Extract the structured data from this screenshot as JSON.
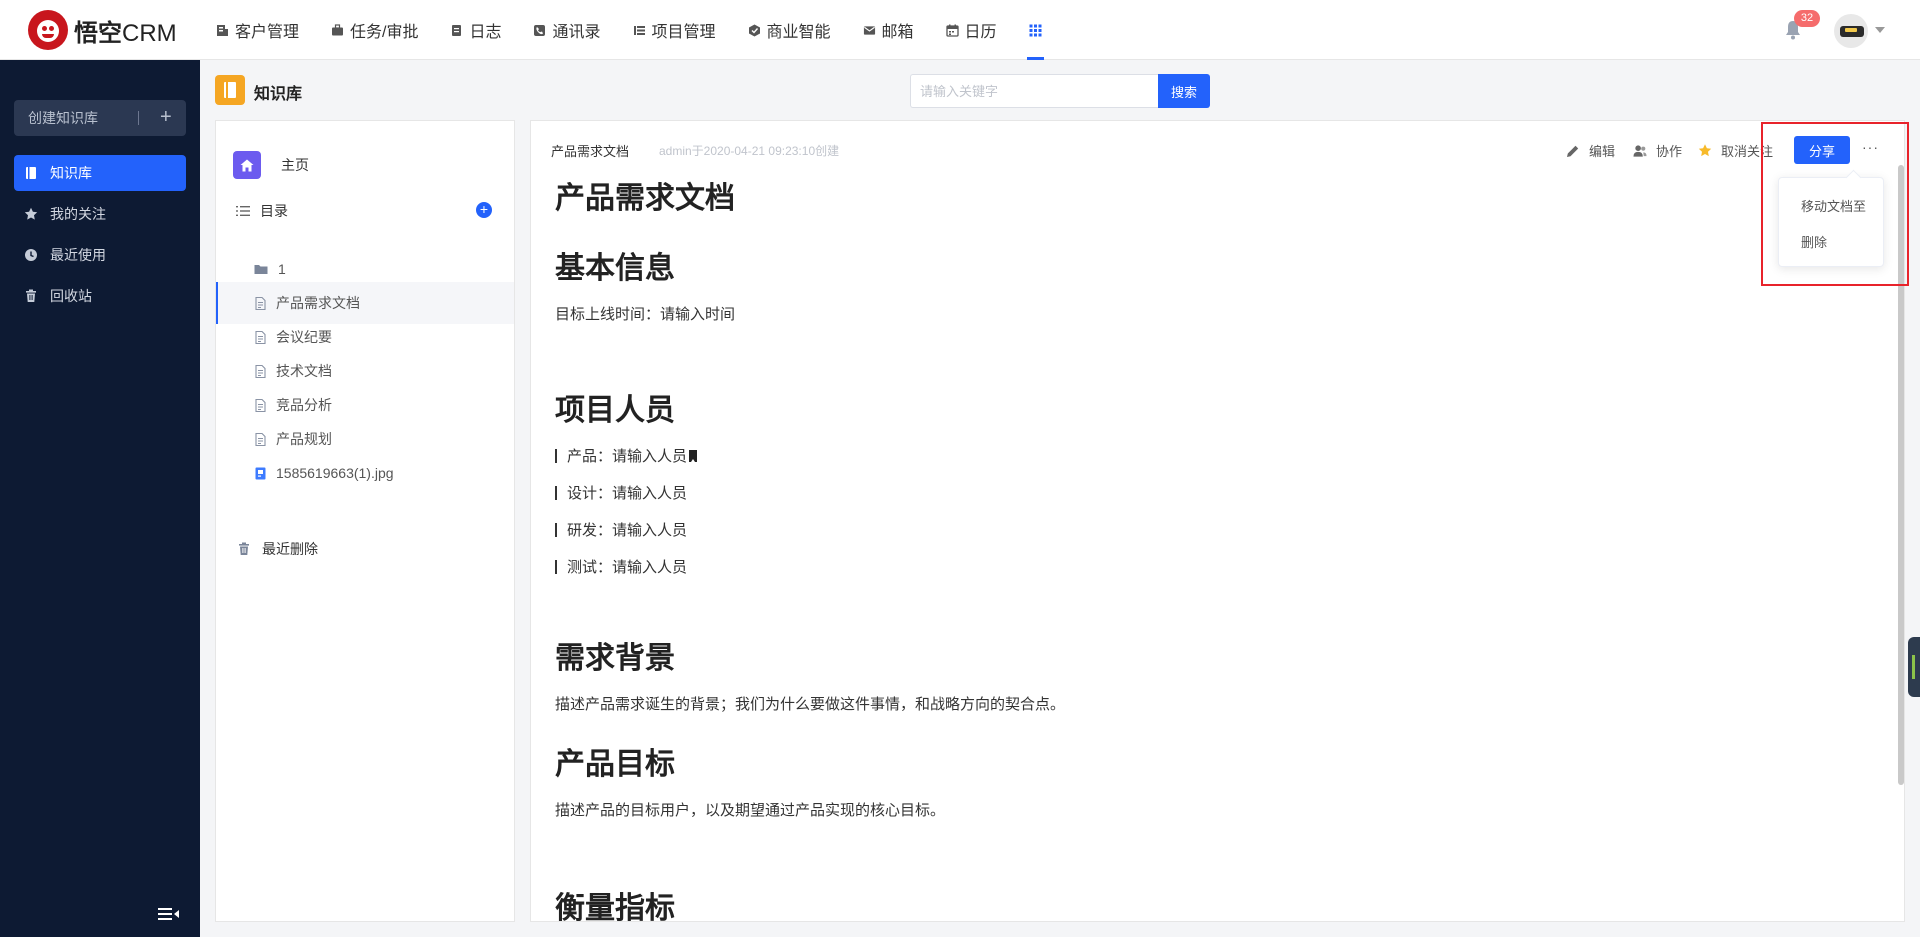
{
  "app": {
    "logo_text_cn": "悟空",
    "logo_text_en": "CRM",
    "notification_count": "32"
  },
  "nav": [
    {
      "label": "客户管理",
      "icon": "customer-icon"
    },
    {
      "label": "任务/审批",
      "icon": "briefcase-icon"
    },
    {
      "label": "日志",
      "icon": "log-icon"
    },
    {
      "label": "通讯录",
      "icon": "contacts-icon"
    },
    {
      "label": "项目管理",
      "icon": "project-icon"
    },
    {
      "label": "商业智能",
      "icon": "bi-icon"
    },
    {
      "label": "邮箱",
      "icon": "mail-icon"
    },
    {
      "label": "日历",
      "icon": "calendar-icon"
    }
  ],
  "sidebar": {
    "create_label": "创建知识库",
    "items": [
      {
        "label": "知识库",
        "icon": "book-icon",
        "active": true
      },
      {
        "label": "我的关注",
        "icon": "star-icon"
      },
      {
        "label": "最近使用",
        "icon": "clock-icon"
      },
      {
        "label": "回收站",
        "icon": "trash-icon"
      }
    ]
  },
  "header": {
    "title": "知识库",
    "search_placeholder": "请输入关键字",
    "search_button": "搜索"
  },
  "tree": {
    "home_label": "主页",
    "dir_label": "目录",
    "items": [
      {
        "label": "1",
        "type": "folder"
      },
      {
        "label": "产品需求文档",
        "type": "doc",
        "active": true
      },
      {
        "label": "会议纪要",
        "type": "doc"
      },
      {
        "label": "技术文档",
        "type": "doc"
      },
      {
        "label": "竞品分析",
        "type": "doc"
      },
      {
        "label": "产品规划",
        "type": "doc"
      },
      {
        "label": "1585619663(1).jpg",
        "type": "image"
      }
    ],
    "recent_deleted_label": "最近删除"
  },
  "document": {
    "crumb": "产品需求文档",
    "meta": "admin于2020-04-21 09:23:10创建",
    "actions": {
      "edit": "编辑",
      "collab": "协作",
      "unfollow": "取消关注",
      "share": "分享",
      "more": "···"
    },
    "dropdown": {
      "move": "移动文档至",
      "delete": "删除"
    },
    "content": {
      "title": "产品需求文档",
      "h_basic": "基本信息",
      "p_launch": "目标上线时间：请输入时间",
      "h_members": "项目人员",
      "members": [
        "产品：请输入人员",
        "设计：请输入人员",
        "研发：请输入人员",
        "测试：请输入人员"
      ],
      "h_background": "需求背景",
      "p_background": "描述产品需求诞生的背景；我们为什么要做这件事情，和战略方向的契合点。",
      "h_goal": "产品目标",
      "p_goal": "描述产品的目标用户，以及期望通过产品实现的核心目标。",
      "h_metrics": "衡量指标"
    }
  },
  "colors": {
    "primary": "#2362fb",
    "sidebar_bg": "#0d1a33",
    "highlight": "#e8232b",
    "kb_badge": "#f5a623",
    "home_icon": "#6c5bef"
  }
}
